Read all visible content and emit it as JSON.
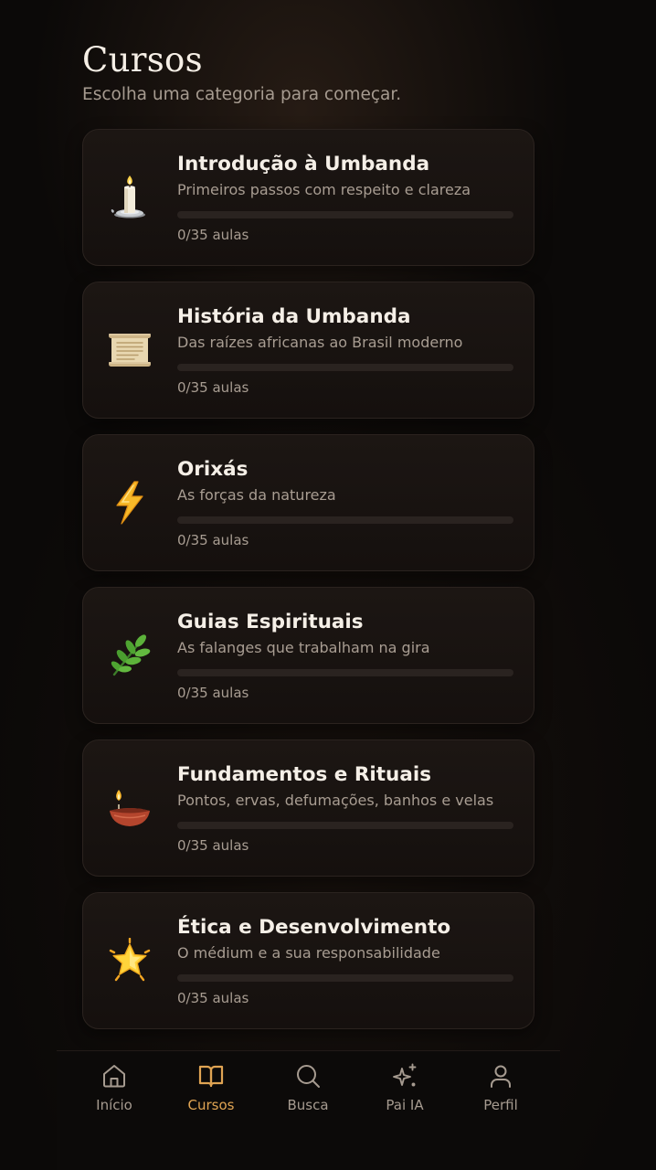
{
  "header": {
    "title": "Cursos",
    "subtitle": "Escolha uma categoria para começar."
  },
  "courses": [
    {
      "icon": "candle-icon",
      "title": "Introdução à Umbanda",
      "description": "Primeiros passos com respeito e clareza",
      "progress_text": "0/35 aulas",
      "progress_fraction": 0
    },
    {
      "icon": "scroll-icon",
      "title": "História da Umbanda",
      "description": "Das raízes africanas ao Brasil moderno",
      "progress_text": "0/35 aulas",
      "progress_fraction": 0
    },
    {
      "icon": "lightning-icon",
      "title": "Orixás",
      "description": "As forças da natureza",
      "progress_text": "0/35 aulas",
      "progress_fraction": 0
    },
    {
      "icon": "herb-icon",
      "title": "Guias Espirituais",
      "description": "As falanges que trabalham na gira",
      "progress_text": "0/35 aulas",
      "progress_fraction": 0
    },
    {
      "icon": "oil-lamp-icon",
      "title": "Fundamentos e Rituais",
      "description": "Pontos, ervas, defumações, banhos e velas",
      "progress_text": "0/35 aulas",
      "progress_fraction": 0
    },
    {
      "icon": "glowing-star-icon",
      "title": "Ética e Desenvolvimento",
      "description": "O médium e a sua responsabilidade",
      "progress_text": "0/35 aulas",
      "progress_fraction": 0
    }
  ],
  "nav": {
    "active": "Cursos",
    "items": [
      {
        "label": "Início",
        "icon": "home-icon"
      },
      {
        "label": "Cursos",
        "icon": "book-icon"
      },
      {
        "label": "Busca",
        "icon": "search-icon"
      },
      {
        "label": "Pai IA",
        "icon": "sparkles-icon"
      },
      {
        "label": "Perfil",
        "icon": "user-icon"
      }
    ]
  },
  "colors": {
    "background": "#0b0908",
    "accent": "#e0a453",
    "text_primary": "#f5efe7",
    "text_secondary": "#a89d92",
    "card": "#1a1411"
  }
}
